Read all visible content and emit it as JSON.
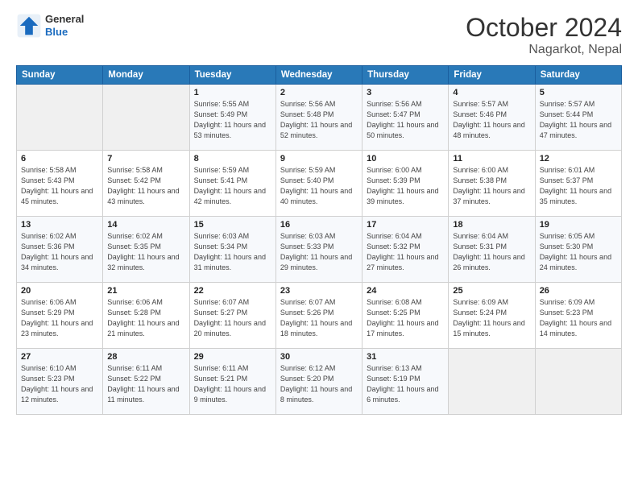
{
  "header": {
    "logo_general": "General",
    "logo_blue": "Blue",
    "title": "October 2024",
    "location": "Nagarkot, Nepal"
  },
  "weekdays": [
    "Sunday",
    "Monday",
    "Tuesday",
    "Wednesday",
    "Thursday",
    "Friday",
    "Saturday"
  ],
  "weeks": [
    [
      {
        "day": "",
        "sunrise": "",
        "sunset": "",
        "daylight": ""
      },
      {
        "day": "",
        "sunrise": "",
        "sunset": "",
        "daylight": ""
      },
      {
        "day": "1",
        "sunrise": "Sunrise: 5:55 AM",
        "sunset": "Sunset: 5:49 PM",
        "daylight": "Daylight: 11 hours and 53 minutes."
      },
      {
        "day": "2",
        "sunrise": "Sunrise: 5:56 AM",
        "sunset": "Sunset: 5:48 PM",
        "daylight": "Daylight: 11 hours and 52 minutes."
      },
      {
        "day": "3",
        "sunrise": "Sunrise: 5:56 AM",
        "sunset": "Sunset: 5:47 PM",
        "daylight": "Daylight: 11 hours and 50 minutes."
      },
      {
        "day": "4",
        "sunrise": "Sunrise: 5:57 AM",
        "sunset": "Sunset: 5:46 PM",
        "daylight": "Daylight: 11 hours and 48 minutes."
      },
      {
        "day": "5",
        "sunrise": "Sunrise: 5:57 AM",
        "sunset": "Sunset: 5:44 PM",
        "daylight": "Daylight: 11 hours and 47 minutes."
      }
    ],
    [
      {
        "day": "6",
        "sunrise": "Sunrise: 5:58 AM",
        "sunset": "Sunset: 5:43 PM",
        "daylight": "Daylight: 11 hours and 45 minutes."
      },
      {
        "day": "7",
        "sunrise": "Sunrise: 5:58 AM",
        "sunset": "Sunset: 5:42 PM",
        "daylight": "Daylight: 11 hours and 43 minutes."
      },
      {
        "day": "8",
        "sunrise": "Sunrise: 5:59 AM",
        "sunset": "Sunset: 5:41 PM",
        "daylight": "Daylight: 11 hours and 42 minutes."
      },
      {
        "day": "9",
        "sunrise": "Sunrise: 5:59 AM",
        "sunset": "Sunset: 5:40 PM",
        "daylight": "Daylight: 11 hours and 40 minutes."
      },
      {
        "day": "10",
        "sunrise": "Sunrise: 6:00 AM",
        "sunset": "Sunset: 5:39 PM",
        "daylight": "Daylight: 11 hours and 39 minutes."
      },
      {
        "day": "11",
        "sunrise": "Sunrise: 6:00 AM",
        "sunset": "Sunset: 5:38 PM",
        "daylight": "Daylight: 11 hours and 37 minutes."
      },
      {
        "day": "12",
        "sunrise": "Sunrise: 6:01 AM",
        "sunset": "Sunset: 5:37 PM",
        "daylight": "Daylight: 11 hours and 35 minutes."
      }
    ],
    [
      {
        "day": "13",
        "sunrise": "Sunrise: 6:02 AM",
        "sunset": "Sunset: 5:36 PM",
        "daylight": "Daylight: 11 hours and 34 minutes."
      },
      {
        "day": "14",
        "sunrise": "Sunrise: 6:02 AM",
        "sunset": "Sunset: 5:35 PM",
        "daylight": "Daylight: 11 hours and 32 minutes."
      },
      {
        "day": "15",
        "sunrise": "Sunrise: 6:03 AM",
        "sunset": "Sunset: 5:34 PM",
        "daylight": "Daylight: 11 hours and 31 minutes."
      },
      {
        "day": "16",
        "sunrise": "Sunrise: 6:03 AM",
        "sunset": "Sunset: 5:33 PM",
        "daylight": "Daylight: 11 hours and 29 minutes."
      },
      {
        "day": "17",
        "sunrise": "Sunrise: 6:04 AM",
        "sunset": "Sunset: 5:32 PM",
        "daylight": "Daylight: 11 hours and 27 minutes."
      },
      {
        "day": "18",
        "sunrise": "Sunrise: 6:04 AM",
        "sunset": "Sunset: 5:31 PM",
        "daylight": "Daylight: 11 hours and 26 minutes."
      },
      {
        "day": "19",
        "sunrise": "Sunrise: 6:05 AM",
        "sunset": "Sunset: 5:30 PM",
        "daylight": "Daylight: 11 hours and 24 minutes."
      }
    ],
    [
      {
        "day": "20",
        "sunrise": "Sunrise: 6:06 AM",
        "sunset": "Sunset: 5:29 PM",
        "daylight": "Daylight: 11 hours and 23 minutes."
      },
      {
        "day": "21",
        "sunrise": "Sunrise: 6:06 AM",
        "sunset": "Sunset: 5:28 PM",
        "daylight": "Daylight: 11 hours and 21 minutes."
      },
      {
        "day": "22",
        "sunrise": "Sunrise: 6:07 AM",
        "sunset": "Sunset: 5:27 PM",
        "daylight": "Daylight: 11 hours and 20 minutes."
      },
      {
        "day": "23",
        "sunrise": "Sunrise: 6:07 AM",
        "sunset": "Sunset: 5:26 PM",
        "daylight": "Daylight: 11 hours and 18 minutes."
      },
      {
        "day": "24",
        "sunrise": "Sunrise: 6:08 AM",
        "sunset": "Sunset: 5:25 PM",
        "daylight": "Daylight: 11 hours and 17 minutes."
      },
      {
        "day": "25",
        "sunrise": "Sunrise: 6:09 AM",
        "sunset": "Sunset: 5:24 PM",
        "daylight": "Daylight: 11 hours and 15 minutes."
      },
      {
        "day": "26",
        "sunrise": "Sunrise: 6:09 AM",
        "sunset": "Sunset: 5:23 PM",
        "daylight": "Daylight: 11 hours and 14 minutes."
      }
    ],
    [
      {
        "day": "27",
        "sunrise": "Sunrise: 6:10 AM",
        "sunset": "Sunset: 5:23 PM",
        "daylight": "Daylight: 11 hours and 12 minutes."
      },
      {
        "day": "28",
        "sunrise": "Sunrise: 6:11 AM",
        "sunset": "Sunset: 5:22 PM",
        "daylight": "Daylight: 11 hours and 11 minutes."
      },
      {
        "day": "29",
        "sunrise": "Sunrise: 6:11 AM",
        "sunset": "Sunset: 5:21 PM",
        "daylight": "Daylight: 11 hours and 9 minutes."
      },
      {
        "day": "30",
        "sunrise": "Sunrise: 6:12 AM",
        "sunset": "Sunset: 5:20 PM",
        "daylight": "Daylight: 11 hours and 8 minutes."
      },
      {
        "day": "31",
        "sunrise": "Sunrise: 6:13 AM",
        "sunset": "Sunset: 5:19 PM",
        "daylight": "Daylight: 11 hours and 6 minutes."
      },
      {
        "day": "",
        "sunrise": "",
        "sunset": "",
        "daylight": ""
      },
      {
        "day": "",
        "sunrise": "",
        "sunset": "",
        "daylight": ""
      }
    ]
  ]
}
